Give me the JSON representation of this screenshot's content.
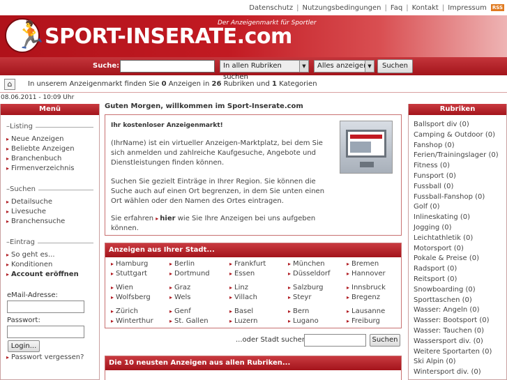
{
  "topnav": {
    "items": [
      "Datenschutz",
      "Nutzungsbedingungen",
      "Faq",
      "Kontakt",
      "Impressum"
    ],
    "rss": "RSS"
  },
  "header": {
    "slogan": "Der Anzeigenmarkt für Sportler",
    "brand": "SPORT-INSERATE.com",
    "logo_icon": "runner-icon"
  },
  "search": {
    "label": "Suche:",
    "input_value": "",
    "scope_select": "In allen Rubriken suchen",
    "filter_select": "Alles anzeigen",
    "button": "Suchen"
  },
  "info": {
    "home_icon": "home-icon",
    "prefix": "In unserem Anzeigenmarkt finden Sie ",
    "ads_count": "0",
    "mid1": " Anzeigen in ",
    "rubriken_count": "26",
    "mid2": " Rubriken und ",
    "kategorien_count": "1",
    "suffix": " Kategorien"
  },
  "date": "08.06.2011 - 10:09 Uhr",
  "menu": {
    "title": "Menü",
    "listing_title": "Listing",
    "listing": [
      "Neue Anzeigen",
      "Beliebte Anzeigen",
      "Branchenbuch",
      "Firmenverzeichnis"
    ],
    "suchen_title": "Suchen",
    "suchen": [
      "Detailsuche",
      "Livesuche",
      "Branchensuche"
    ],
    "eintrag_title": "Eintrag",
    "eintrag": [
      "So geht es...",
      "Konditionen",
      "Account eröffnen"
    ],
    "email_label": "eMail-Adresse:",
    "password_label": "Passwort:",
    "login_button": "Login...",
    "forgot": "Passwort vergessen?"
  },
  "main": {
    "welcome": "Guten Morgen, willkommen im Sport-Inserate.com",
    "box_title": "Ihr kostenloser Anzeigenmarkt!",
    "p1": "(IhrName) ist ein virtueller Anzeigen-Marktplatz, bei dem Sie sich anmelden und zahlreiche Kaufgesuche, Angebote und Dienstleistungen finden können.",
    "p2": "Suchen Sie gezielt Einträge in Ihrer Region. Sie können die Suche auch auf einen Ort begrenzen, in dem Sie unten einen Ort wählen oder den Namen des Ortes eintragen.",
    "p3_a": "Sie erfahren ",
    "p3_link": "hier",
    "p3_b": " wie Sie Ihre Anzeigen bei uns aufgeben können.",
    "cities_title": "Anzeigen aus Ihrer Stadt...",
    "cities": [
      [
        "Hamburg",
        "Berlin",
        "Frankfurt",
        "München",
        "Bremen"
      ],
      [
        "Stuttgart",
        "Dortmund",
        "Essen",
        "Düsseldorf",
        "Hannover"
      ],
      [
        "Wien",
        "Graz",
        "Linz",
        "Salzburg",
        "Innsbruck"
      ],
      [
        "Wolfsberg",
        "Wels",
        "Villach",
        "Steyr",
        "Bregenz"
      ],
      [
        "Zürich",
        "Genf",
        "Basel",
        "Bern",
        "Lausanne"
      ],
      [
        "Winterthur",
        "St. Gallen",
        "Luzern",
        "Lugano",
        "Freiburg"
      ]
    ],
    "city_search_label": "...oder Stadt suchen:",
    "city_search_button": "Suchen",
    "latest_title": "Die 10 neusten Anzeigen aus allen Rubriken..."
  },
  "rubriken": {
    "title": "Rubriken",
    "items": [
      "Ballsport div (0)",
      "Camping & Outdoor (0)",
      "Fanshop (0)",
      "Ferien/Trainingslager (0)",
      "Fitness (0)",
      "Funsport (0)",
      "Fussball (0)",
      "Fussball-Fanshop (0)",
      "Golf (0)",
      "Inlineskating (0)",
      "Jogging (0)",
      "Leichtathletik (0)",
      "Motorsport (0)",
      "Pokale & Preise (0)",
      "Radsport (0)",
      "Reitsport (0)",
      "Snowboarding (0)",
      "Sporttaschen (0)",
      "Wasser: Angeln (0)",
      "Wasser: Bootsport (0)",
      "Wasser: Tauchen (0)",
      "Wassersport div. (0)",
      "Weitere Sportarten (0)",
      "Ski Alpin (0)",
      "Wintersport div. (0)"
    ]
  }
}
